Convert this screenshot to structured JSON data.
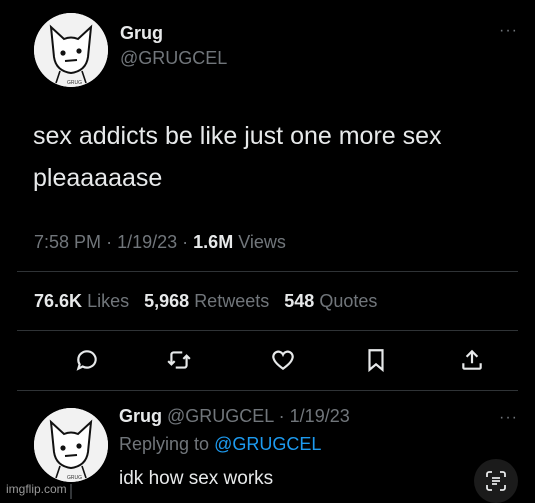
{
  "tweet": {
    "author_name": "Grug",
    "author_handle": "@GRUGCEL",
    "avatar_caption": "GRUG",
    "text_line1": "sex addicts be like just one more sex",
    "text_line2": "pleaaaaase",
    "time": "7:58 PM",
    "sep1": "·",
    "date": "1/19/23",
    "sep2": "·",
    "views_count": "1.6M",
    "views_label": "Views",
    "likes_count": "76.6K",
    "likes_label": "Likes",
    "retweets_count": "5,968",
    "retweets_label": "Retweets",
    "quotes_count": "548",
    "quotes_label": "Quotes",
    "more_label": "···"
  },
  "actions": [
    "reply-icon",
    "retweet-icon",
    "like-icon",
    "bookmark-icon",
    "share-icon"
  ],
  "reply": {
    "author_name": "Grug",
    "author_handle": "@GRUGCEL",
    "sep": "·",
    "date": "1/19/23",
    "replying_prefix": "Replying to",
    "replying_handle": "@GRUGCEL",
    "text": "idk how sex works",
    "avatar_caption": "GRUG",
    "more_label": "···"
  },
  "watermark": "imgflip.com"
}
